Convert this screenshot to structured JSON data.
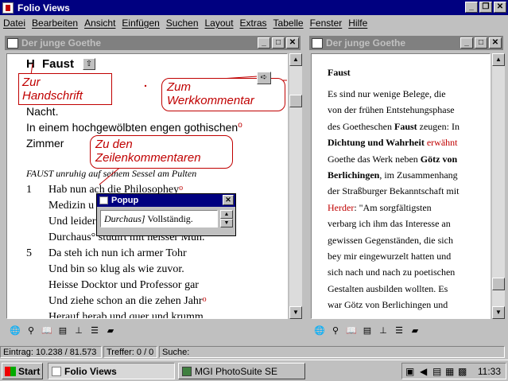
{
  "app": {
    "title": "Folio Views"
  },
  "menu": [
    "Datei",
    "Bearbeiten",
    "Ansicht",
    "Einfügen",
    "Suchen",
    "Layout",
    "Extras",
    "Tabelle",
    "Fenster",
    "Hilfe"
  ],
  "left_window": {
    "title": "Der junge Goethe",
    "heading_marker": "H",
    "heading": "Faust",
    "lines_top": [
      "Nacht.",
      "In einem hochgewölbten engen gothischen",
      "Zimmer"
    ],
    "stage_direction": "FAUST unruhig auf seinem Sessel am Pulten",
    "verses": [
      {
        "num": "1",
        "text": "Hab nun ach die Philosophey"
      },
      {
        "num": "",
        "text": "Medizin u"
      },
      {
        "num": "",
        "text": "Und leider"
      },
      {
        "num": "",
        "text": "Durchaus° studirt mit heisser Müh."
      },
      {
        "num": "5",
        "text": "Da steh ich nun ich armer Tohr"
      },
      {
        "num": "",
        "text": "Und bin so klug als wie zuvor."
      },
      {
        "num": "",
        "text": "Heisse Docktor und Professor gar"
      },
      {
        "num": "",
        "text": "Und ziehe schon an die zehen Jahr"
      },
      {
        "num": "",
        "text": "Herauf herab und quer und krumm"
      }
    ],
    "callouts": {
      "handschrift": [
        "Zur",
        "Handschrift"
      ],
      "werkkommentar": [
        "Zum",
        "Werkkommentar"
      ],
      "zeilenkommentare": [
        "Zu den",
        "Zeilenkommentaren"
      ]
    }
  },
  "popup": {
    "title": "Popup",
    "italic": "Durchaus]",
    "text": " Vollständig."
  },
  "right_window": {
    "title": "Der junge Goethe",
    "heading": "Faust",
    "paragraph_html": "Es sind nur wenige Belege, die von der frühen Entstehungsphase des Goetheschen <b>Faust</b> zeugen: In <b>Dichtung und Wahrheit</b> <span class=\"red\">erwähnt</span> Goethe das Werk neben <b>Götz von Berlichingen</b>, im Zusammenhang der Straßburger Bekanntschaft mit <span class=\"red\">Herder</span>: \"Am sorgfältigsten verbarg ich ihm das Interesse an gewissen Gegenständen, die sich bey mir eingewurzelt hatten und sich nach und nach zu poetischen Gestalten ausbilden wollten. Es war Götz von Berlichingen und Faust. Die Lebensbeschreibung des erstern hatte mich im Innersten ergriffen ... Die bedeutende Puppenspielfabel des"
  },
  "status": {
    "entry": "Eintrag: 10.238 / 81.573",
    "hits": "Treffer: 0 / 0",
    "search": "Suche:"
  },
  "taskbar": {
    "start": "Start",
    "tasks": [
      "Folio Views",
      "MGI PhotoSuite SE"
    ],
    "clock": "11:33"
  },
  "colors": {
    "titlebar": "#000080",
    "inactive_title": "#808080",
    "face": "#c0c0c0",
    "annotation": "#c00000"
  }
}
